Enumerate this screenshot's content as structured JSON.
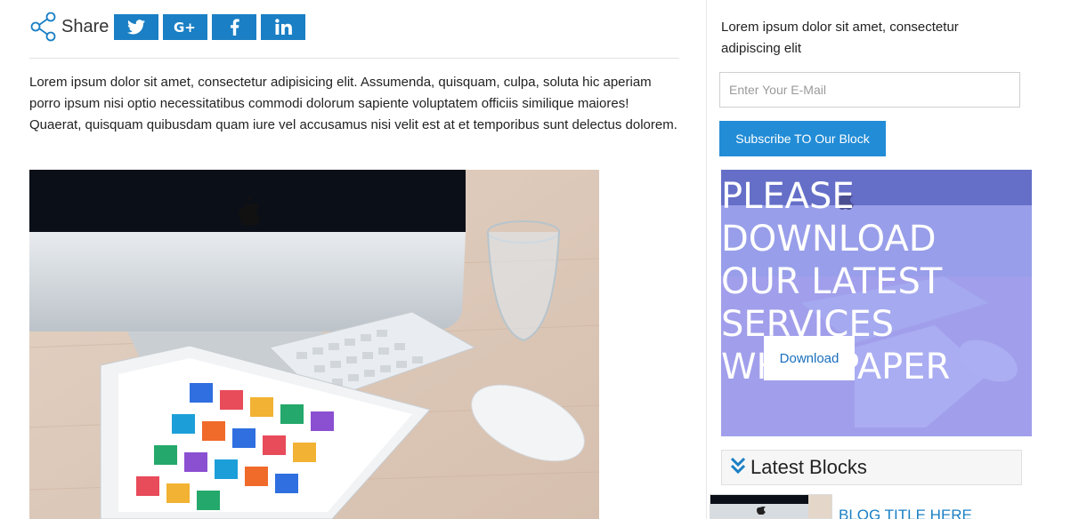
{
  "share": {
    "label": "Share",
    "buttons": [
      {
        "icon": "twitter-icon"
      },
      {
        "icon": "google-plus-icon"
      },
      {
        "icon": "facebook-icon"
      },
      {
        "icon": "linkedin-icon"
      }
    ]
  },
  "main": {
    "intro": "Lorem ipsum dolor sit amet, consectetur adipisicing elit. Assumenda, quisquam, culpa, soluta hic aperiam porro ipsum nisi optio necessitatibus commodi dolorum sapiente voluptatem officiis similique maiores! Quaerat, quisquam quibusdam quam iure vel accusamus nisi velit est at et temporibus sunt delectus dolorem."
  },
  "sidebar": {
    "subscribe_text": "Lorem ipsum dolor sit amet, consectetur adipiscing elit",
    "email_placeholder": "Enter Your E-Mail",
    "subscribe_label": "Subscribe TO Our Block",
    "promo_title": "PLEASE DOWNLOAD OUR LATEST SERVICES WHITEPAPER",
    "download_label": "Download",
    "latest_title": "Latest Blocks",
    "blog_title": "BLOG TITLE HERE"
  },
  "colors": {
    "accent": "#1a7fc4",
    "subscribe_button": "#228cd6",
    "promo_overlay": "#6e73eb"
  }
}
